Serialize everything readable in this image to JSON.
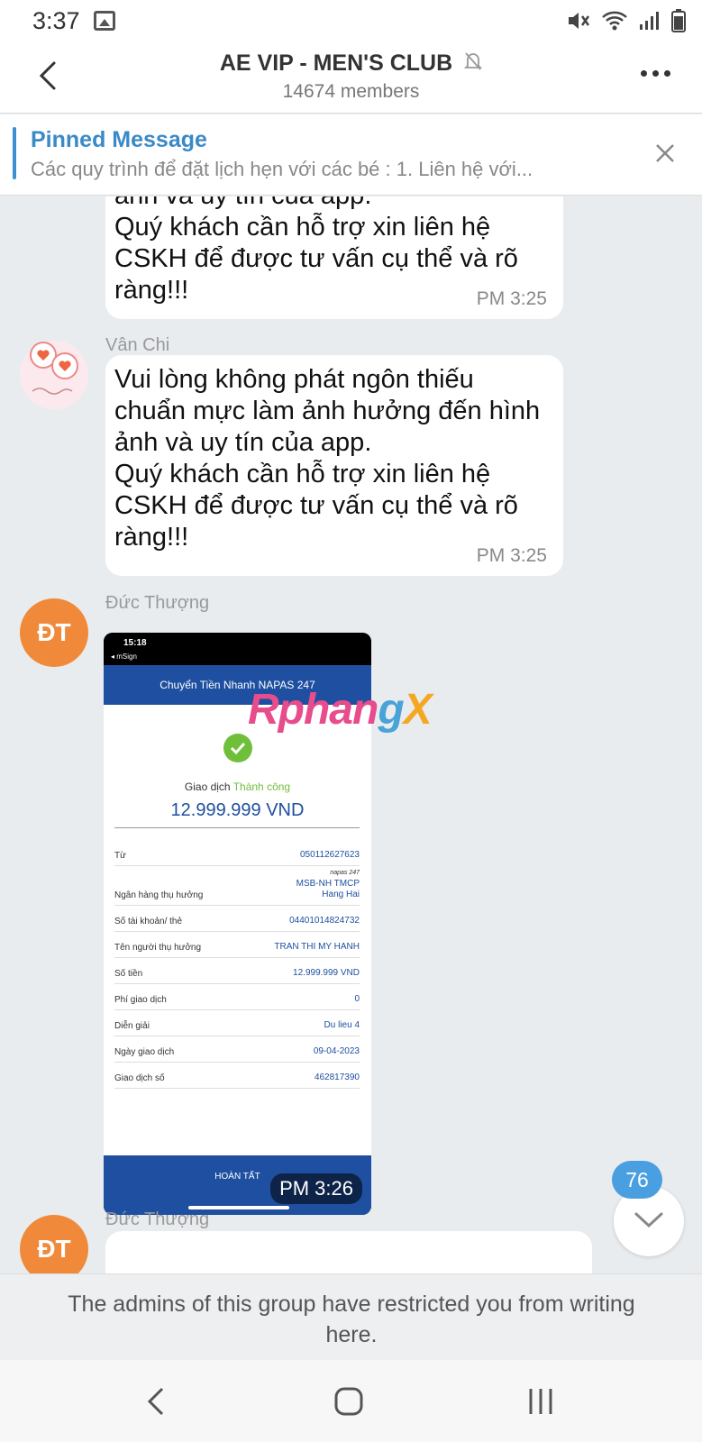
{
  "status_bar": {
    "time": "3:37"
  },
  "header": {
    "title": "AE VIP -  MEN'S CLUB",
    "subtitle": "14674 members"
  },
  "pinned": {
    "title": "Pinned Message",
    "text": "Các quy trình để đặt lịch hẹn với các bé : 1. Liên hệ với..."
  },
  "messages": [
    {
      "text": "ảnh và uy tín của app.\nQuý khách cần hỗ trợ xin liên hệ CSKH để được tư vấn cụ thể và rõ ràng!!!",
      "time": "PM  3:25"
    },
    {
      "sender": "Vân Chi",
      "text": "Vui lòng không phát ngôn thiếu chuẩn mực làm ảnh hưởng đến hình ảnh và uy tín của app.\nQuý khách cần hỗ trợ xin liên hệ CSKH để được tư vấn cụ thể và rõ ràng!!!",
      "time": "PM  3:25"
    },
    {
      "sender": "Đức Thượng",
      "avatar": "ĐT",
      "time": "PM  3:26"
    },
    {
      "sender": "Đức Thượng",
      "avatar": "ĐT"
    }
  ],
  "receipt": {
    "phone_time": "15:18",
    "phone_app": "◂ mSign",
    "banner": "Chuyển Tiền Nhanh NAPAS 247",
    "status_prefix": "Giao dịch ",
    "status_ok": "Thành công",
    "amount": "12.999.999 VND",
    "rows": [
      {
        "k": "Từ",
        "v": "050112627623"
      },
      {
        "k": "Ngân hàng thụ hưởng",
        "napas": "napas 247",
        "v": "MSB-NH TMCP\nHang Hai"
      },
      {
        "k": "Số tài khoản/ thẻ",
        "v": "04401014824732"
      },
      {
        "k": "Tên người thụ hưởng",
        "v": "TRAN THI MY HANH"
      },
      {
        "k": "Số tiền",
        "v": "12.999.999 VND"
      },
      {
        "k": "Phí giao dịch",
        "v": "0"
      },
      {
        "k": "Diễn giải",
        "v": "Du lieu 4"
      },
      {
        "k": "Ngày giao dịch",
        "v": "09-04-2023"
      },
      {
        "k": "Giao dịch số",
        "v": "462817390"
      }
    ],
    "footer": "HOÀN TẤT",
    "watermark": {
      "a": "Rphan",
      "g": "g",
      "x": "X"
    }
  },
  "unread_count": "76",
  "restriction_text": "The admins of this group have restricted you from writing here."
}
